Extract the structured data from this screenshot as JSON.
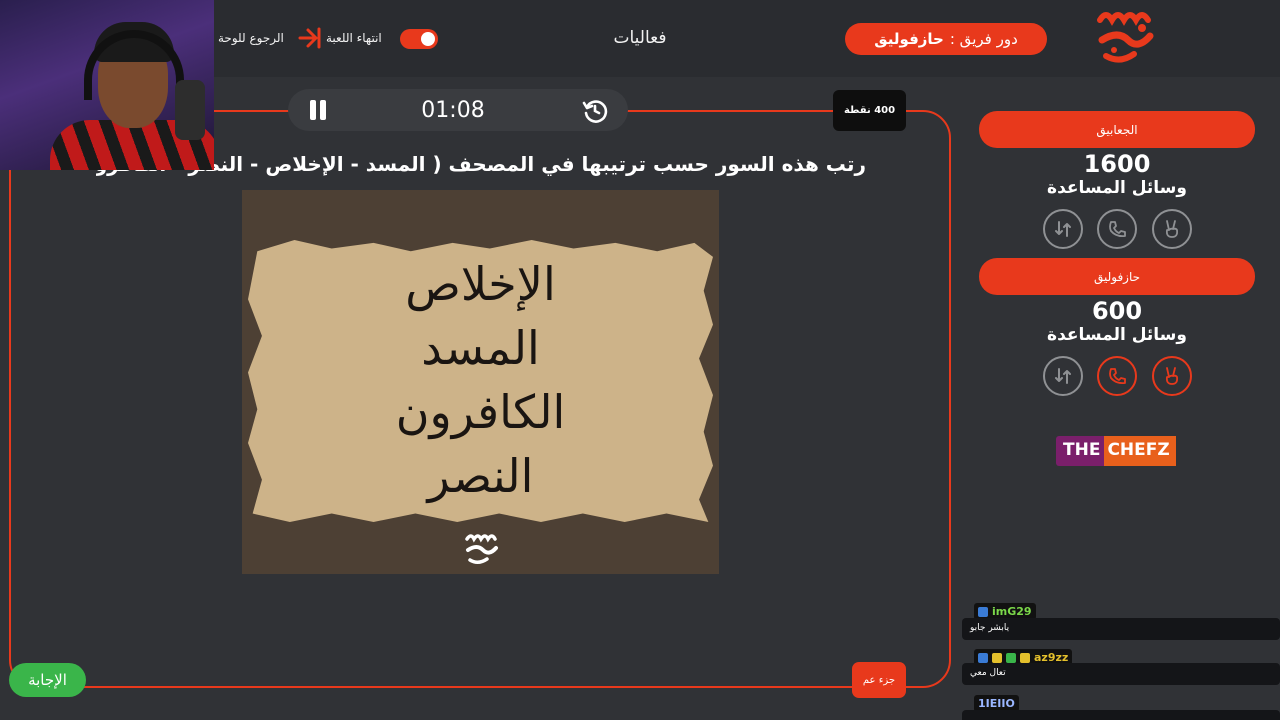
{
  "header": {
    "turn_label": "دور فريق :",
    "turn_team": "حازفوليق",
    "page_title": "فعاليات",
    "end_game": "انتهاء اللعبة",
    "back_to_board": "الرجوع للوحة"
  },
  "timer": {
    "value": "01:08"
  },
  "question": {
    "points": "400 نقطة",
    "text": "رتب هذه السور حسب ترتيبها في المصحف ( المسد - الإخلاص - النصر - الكافرون ) .",
    "image_lines": [
      "الإخلاص",
      "المسد",
      "الكافرون",
      "النصر"
    ],
    "category": "جزء عم"
  },
  "answer_button": "الإجابة",
  "teams": [
    {
      "name": "الجعابيق",
      "score": "1600",
      "helpers_title": "وسائل المساعدة",
      "helpers": [
        {
          "icon": "swap-icon",
          "used": false
        },
        {
          "icon": "phone-icon",
          "used": false
        },
        {
          "icon": "peace-hand-icon",
          "used": false
        }
      ]
    },
    {
      "name": "حازفوليق",
      "score": "600",
      "helpers_title": "وسائل المساعدة",
      "helpers": [
        {
          "icon": "swap-icon",
          "used": false
        },
        {
          "icon": "phone-icon",
          "used": true
        },
        {
          "icon": "peace-hand-icon",
          "used": true
        }
      ]
    }
  ],
  "sponsor": {
    "part1": "THE",
    "part2": "CHEFZ"
  },
  "chat": [
    {
      "user": "imG29",
      "user_color": "#7bd84a",
      "message": "يابشر جابو"
    },
    {
      "user": "az9zz",
      "user_color": "#e4c02c",
      "message": "تعال معي"
    },
    {
      "user": "1IEIIO",
      "user_color": "#9ab6ff",
      "message": ""
    }
  ],
  "colors": {
    "accent": "#e8391c",
    "answer": "#3ab54a",
    "background": "#303236"
  }
}
